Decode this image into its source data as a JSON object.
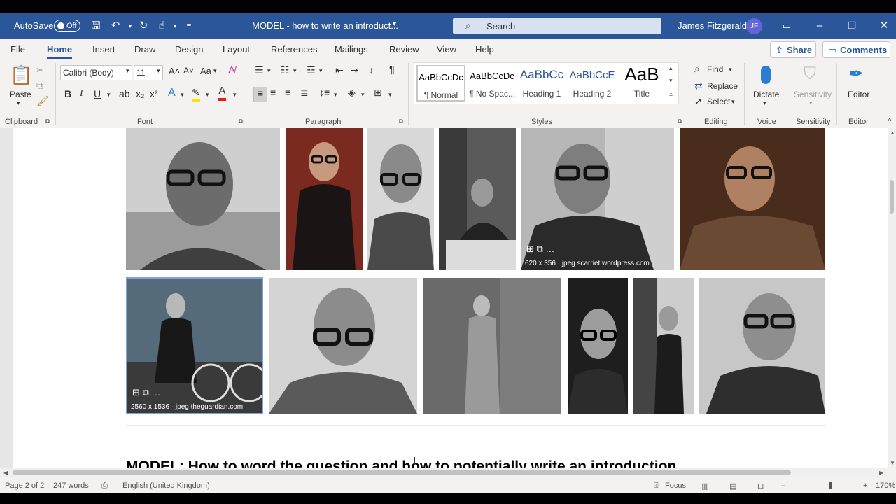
{
  "titlebar": {
    "autosave_label": "AutoSave",
    "autosave_state": "Off",
    "document_title": "MODEL - how to write an introduct...",
    "search_placeholder": "Search",
    "user_name": "James Fitzgerald",
    "user_initials": "JF"
  },
  "menu": {
    "tabs": [
      "File",
      "Home",
      "Insert",
      "Draw",
      "Design",
      "Layout",
      "References",
      "Mailings",
      "Review",
      "View",
      "Help"
    ],
    "active": "Home",
    "share_label": "Share",
    "comments_label": "Comments"
  },
  "ribbon": {
    "clipboard": {
      "paste_label": "Paste",
      "group_label": "Clipboard"
    },
    "font": {
      "font_name": "Calibri (Body)",
      "font_size": "11",
      "group_label": "Font",
      "case_label": "Aa"
    },
    "paragraph": {
      "group_label": "Paragraph"
    },
    "styles": {
      "group_label": "Styles",
      "items": [
        {
          "sample": "AaBbCcDc",
          "name": "¶ Normal"
        },
        {
          "sample": "AaBbCcDc",
          "name": "¶ No Spac..."
        },
        {
          "sample": "AaBbCc",
          "name": "Heading 1"
        },
        {
          "sample": "AaBbCcE",
          "name": "Heading 2"
        },
        {
          "sample": "AaB",
          "name": "Title"
        }
      ]
    },
    "editing": {
      "find_label": "Find",
      "replace_label": "Replace",
      "select_label": "Select",
      "group_label": "Editing"
    },
    "voice": {
      "dictate_label": "Dictate",
      "group_label": "Voice"
    },
    "sensitivity": {
      "button_label": "Sensitivity",
      "group_label": "Sensitivity"
    },
    "editor": {
      "button_label": "Editor",
      "group_label": "Editor"
    }
  },
  "document": {
    "image_overlays": [
      {
        "tools": "⊞ ⧉ …",
        "caption": "620 x 356 · jpeg  scarriet.wordpress.com"
      },
      {
        "tools": "⊞ ⧉ …",
        "caption": "2560 x 1536 · jpeg  theguardian.com"
      }
    ],
    "heading": "MODEL: How to word the question and how to potentially write an introduction"
  },
  "statusbar": {
    "page": "Page 2 of 2",
    "words": "247 words",
    "language": "English (United Kingdom)",
    "focus": "Focus",
    "zoom": "170%"
  },
  "colors": {
    "accent": "#2b579a",
    "selection_frame": "#7aa3d8"
  }
}
